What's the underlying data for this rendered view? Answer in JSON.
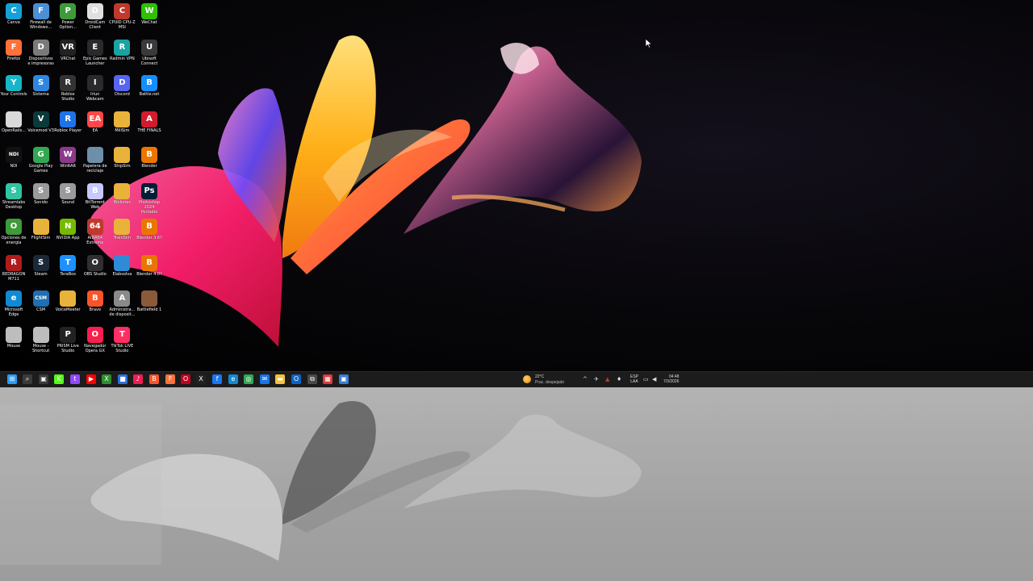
{
  "desktop": {
    "icons": [
      {
        "label": "Canva",
        "color": "#16a0d8",
        "glyph": "C",
        "col": 0,
        "row": 0
      },
      {
        "label": "Firewall de Windows...",
        "color": "#4b8fd6",
        "glyph": "F",
        "col": 1,
        "row": 0
      },
      {
        "label": "Power Option...",
        "color": "#3e9a3a",
        "glyph": "P",
        "col": 2,
        "row": 0
      },
      {
        "label": "DroidCam Client",
        "color": "#e0e0e0",
        "glyph": "D",
        "col": 3,
        "row": 0
      },
      {
        "label": "CPUID CPU-Z MSI",
        "color": "#c0392b",
        "glyph": "C",
        "col": 4,
        "row": 0
      },
      {
        "label": "WeChat",
        "color": "#2dc100",
        "glyph": "W",
        "col": 5,
        "row": 0
      },
      {
        "label": "Firefox",
        "color": "#ff7139",
        "glyph": "F",
        "col": 0,
        "row": 1
      },
      {
        "label": "Dispositivos e impresoras",
        "color": "#7a7a7a",
        "glyph": "D",
        "col": 1,
        "row": 1
      },
      {
        "label": "VRChat",
        "color": "#222222",
        "glyph": "VR",
        "col": 2,
        "row": 1
      },
      {
        "label": "Epic Games Launcher",
        "color": "#2a2a2a",
        "glyph": "E",
        "col": 3,
        "row": 1
      },
      {
        "label": "Radmin VPN",
        "color": "#1aa3a3",
        "glyph": "R",
        "col": 4,
        "row": 1
      },
      {
        "label": "Ubisoft Connect",
        "color": "#3a3a3a",
        "glyph": "U",
        "col": 5,
        "row": 1
      },
      {
        "label": "Your Controls",
        "color": "#18b5c8",
        "glyph": "Y",
        "col": 0,
        "row": 2
      },
      {
        "label": "Sistema",
        "color": "#2e86de",
        "glyph": "S",
        "col": 1,
        "row": 2
      },
      {
        "label": "Roblox Studio",
        "color": "#333333",
        "glyph": "R",
        "col": 2,
        "row": 2
      },
      {
        "label": "Iriun Webcam",
        "color": "#2a2a2a",
        "glyph": "I",
        "col": 3,
        "row": 2
      },
      {
        "label": "Discord",
        "color": "#5865f2",
        "glyph": "D",
        "col": 4,
        "row": 2
      },
      {
        "label": "Battle.net",
        "color": "#148eff",
        "glyph": "B",
        "col": 5,
        "row": 2
      },
      {
        "label": "OpenRails...",
        "color": "#d9d9d9",
        "glyph": "",
        "col": 0,
        "row": 3
      },
      {
        "label": "Voicemod V3",
        "color": "#0b3a3a",
        "glyph": "V",
        "col": 1,
        "row": 3
      },
      {
        "label": "Roblox Player",
        "color": "#1e73e8",
        "glyph": "R",
        "col": 2,
        "row": 3
      },
      {
        "label": "EA",
        "color": "#ff4747",
        "glyph": "EA",
        "col": 3,
        "row": 3
      },
      {
        "label": "MillSim",
        "color": "#e9b23a",
        "glyph": "",
        "col": 4,
        "row": 3
      },
      {
        "label": "THE FINALS",
        "color": "#d11c2f",
        "glyph": "A",
        "col": 5,
        "row": 3
      },
      {
        "label": "NDI",
        "color": "#111111",
        "glyph": "NDI",
        "col": 0,
        "row": 4
      },
      {
        "label": "Google Play Games",
        "color": "#33a852",
        "glyph": "G",
        "col": 1,
        "row": 4
      },
      {
        "label": "WinRAR",
        "color": "#8b3a8b",
        "glyph": "W",
        "col": 2,
        "row": 4
      },
      {
        "label": "Papelera de reciclaje",
        "color": "#6d8fa8",
        "glyph": "",
        "col": 3,
        "row": 4
      },
      {
        "label": "ShipSim",
        "color": "#e9b23a",
        "glyph": "",
        "col": 4,
        "row": 4
      },
      {
        "label": "Blender",
        "color": "#ea7600",
        "glyph": "B",
        "col": 5,
        "row": 4
      },
      {
        "label": "Streamlabs Desktop",
        "color": "#31c3a2",
        "glyph": "S",
        "col": 0,
        "row": 5
      },
      {
        "label": "Sonido",
        "color": "#9a9a9a",
        "glyph": "S",
        "col": 1,
        "row": 5
      },
      {
        "label": "Sound",
        "color": "#9a9a9a",
        "glyph": "S",
        "col": 2,
        "row": 5
      },
      {
        "label": "BitTorrent Web",
        "color": "#c8c8ff",
        "glyph": "B",
        "col": 3,
        "row": 5
      },
      {
        "label": "Bibliotec",
        "color": "#e9b23a",
        "glyph": "",
        "col": 4,
        "row": 5
      },
      {
        "label": "Photoshop 2024 Portable",
        "color": "#001e36",
        "glyph": "Ps",
        "col": 5,
        "row": 5
      },
      {
        "label": "Opciones de energía",
        "color": "#3e9a3a",
        "glyph": "O",
        "col": 0,
        "row": 6
      },
      {
        "label": "FlightSim",
        "color": "#e9b23a",
        "glyph": "",
        "col": 1,
        "row": 6
      },
      {
        "label": "NVIDIA App",
        "color": "#76b900",
        "glyph": "N",
        "col": 2,
        "row": 6
      },
      {
        "label": "AIDA64 Extreme",
        "color": "#c0392b",
        "glyph": "64",
        "col": 3,
        "row": 6
      },
      {
        "label": "TrainSim",
        "color": "#e9b23a",
        "glyph": "",
        "col": 4,
        "row": 6
      },
      {
        "label": "Blender 3.6?",
        "color": "#ea7600",
        "glyph": "B",
        "col": 5,
        "row": 6
      },
      {
        "label": "REDRAGON M711",
        "color": "#b01c1c",
        "glyph": "R",
        "col": 0,
        "row": 7
      },
      {
        "label": "Steam",
        "color": "#1b2838",
        "glyph": "S",
        "col": 1,
        "row": 7
      },
      {
        "label": "TeraBox",
        "color": "#1e90ff",
        "glyph": "T",
        "col": 2,
        "row": 7
      },
      {
        "label": "OBS Studio",
        "color": "#302e31",
        "glyph": "O",
        "col": 3,
        "row": 7
      },
      {
        "label": "Elabsolva",
        "color": "#2f8bd6",
        "glyph": "",
        "col": 4,
        "row": 7
      },
      {
        "label": "Blender 4.0?",
        "color": "#ea7600",
        "glyph": "B",
        "col": 5,
        "row": 7
      },
      {
        "label": "Microsoft Edge",
        "color": "#0f8ad3",
        "glyph": "e",
        "col": 0,
        "row": 8
      },
      {
        "label": "CSM",
        "color": "#1f6fb2",
        "glyph": "CSM",
        "col": 1,
        "row": 8
      },
      {
        "label": "VoiceMeeter",
        "color": "#e9b23a",
        "glyph": "",
        "col": 2,
        "row": 8
      },
      {
        "label": "Brave",
        "color": "#fb542b",
        "glyph": "B",
        "col": 3,
        "row": 8
      },
      {
        "label": "Administra... de disposit...",
        "color": "#8a8a8a",
        "glyph": "A",
        "col": 4,
        "row": 8
      },
      {
        "label": "Battlefield 1",
        "color": "#8a5a3a",
        "glyph": "",
        "col": 5,
        "row": 8
      },
      {
        "label": "Mouse",
        "color": "#bdbdbd",
        "glyph": "",
        "col": 0,
        "row": 9
      },
      {
        "label": "Mouse - Shortcut",
        "color": "#bdbdbd",
        "glyph": "",
        "col": 1,
        "row": 9
      },
      {
        "label": "PRISM Live Studio",
        "color": "#222222",
        "glyph": "P",
        "col": 2,
        "row": 9
      },
      {
        "label": "Navegador Opera GX",
        "color": "#fa1e4e",
        "glyph": "O",
        "col": 3,
        "row": 9
      },
      {
        "label": "TikTok LIVE Studio",
        "color": "#ff2e63",
        "glyph": "T",
        "col": 4,
        "row": 9
      }
    ]
  },
  "taskbar": {
    "apps": [
      {
        "name": "start-button",
        "glyph": "⊞",
        "color": "#2b9bf4"
      },
      {
        "name": "search-icon",
        "glyph": "⌕",
        "color": "#3a3a3a"
      },
      {
        "name": "task-view-icon",
        "glyph": "▣",
        "color": "#3a3a3a"
      },
      {
        "name": "kick-icon",
        "glyph": "K",
        "color": "#53fc18"
      },
      {
        "name": "twitch-icon",
        "glyph": "t",
        "color": "#9146ff"
      },
      {
        "name": "youtube-icon",
        "glyph": "▶",
        "color": "#ff0000"
      },
      {
        "name": "xbox-icon",
        "glyph": "X",
        "color": "#2f8f2f"
      },
      {
        "name": "store-icon",
        "glyph": "■",
        "color": "#2b6fe0"
      },
      {
        "name": "tiktok-icon",
        "glyph": "♪",
        "color": "#ee1d52"
      },
      {
        "name": "brave-icon",
        "glyph": "B",
        "color": "#fb542b"
      },
      {
        "name": "firefox-icon",
        "glyph": "F",
        "color": "#ff7139"
      },
      {
        "name": "opera-icon",
        "glyph": "O",
        "color": "#c4001e"
      },
      {
        "name": "x-icon",
        "glyph": "X",
        "color": "#222222"
      },
      {
        "name": "facebook-icon",
        "glyph": "f",
        "color": "#1877f2"
      },
      {
        "name": "edge-icon",
        "glyph": "e",
        "color": "#0f8ad3"
      },
      {
        "name": "chrome-icon",
        "glyph": "◎",
        "color": "#34a853"
      },
      {
        "name": "mail-icon",
        "glyph": "✉",
        "color": "#1a73e8"
      },
      {
        "name": "file-explorer-icon",
        "glyph": "▬",
        "color": "#f3c13a"
      },
      {
        "name": "outlook-icon",
        "glyph": "O",
        "color": "#0a64c8"
      },
      {
        "name": "store-bag-icon",
        "glyph": "⧉",
        "color": "#4a4a4a"
      },
      {
        "name": "calendar-icon",
        "glyph": "▦",
        "color": "#d93a3a"
      },
      {
        "name": "desktop-app-icon",
        "glyph": "▣",
        "color": "#3a7bd5"
      }
    ],
    "weather": {
      "temp": "22°C",
      "condition": "Prac. despejado"
    },
    "tray": {
      "chevron": "^",
      "language_line1": "ESP",
      "language_line2": "LAA",
      "time": "04:48",
      "date": "7/3/2026"
    }
  }
}
